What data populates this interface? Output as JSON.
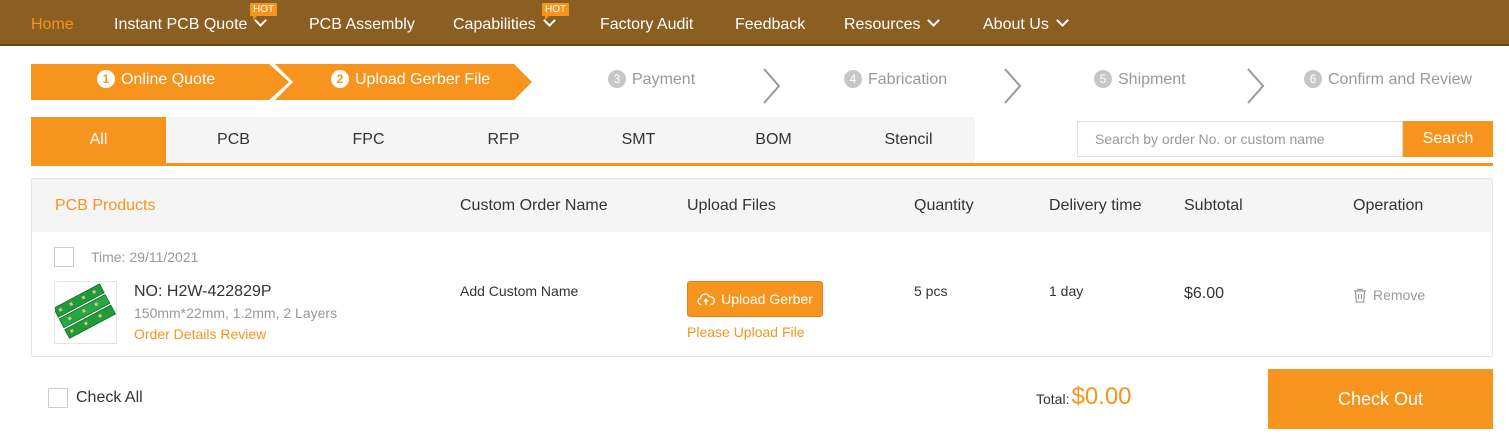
{
  "nav": {
    "items": [
      {
        "label": "Home"
      },
      {
        "label": "Instant PCB Quote",
        "badge": "HOT"
      },
      {
        "label": "PCB Assembly"
      },
      {
        "label": "Capabilities",
        "badge": "HOT"
      },
      {
        "label": "Factory Audit"
      },
      {
        "label": "Feedback"
      },
      {
        "label": "Resources"
      },
      {
        "label": "About Us"
      }
    ]
  },
  "steps": [
    {
      "num": "1",
      "label": "Online Quote"
    },
    {
      "num": "2",
      "label": "Upload Gerber File"
    },
    {
      "num": "3",
      "label": "Payment"
    },
    {
      "num": "4",
      "label": "Fabrication"
    },
    {
      "num": "5",
      "label": "Shipment"
    },
    {
      "num": "6",
      "label": "Confirm and Review"
    }
  ],
  "tabs": [
    {
      "label": "All"
    },
    {
      "label": "PCB"
    },
    {
      "label": "FPC"
    },
    {
      "label": "RFP"
    },
    {
      "label": "SMT"
    },
    {
      "label": "BOM"
    },
    {
      "label": "Stencil"
    }
  ],
  "search": {
    "placeholder": "Search by order No. or custom name",
    "value": "",
    "button": "Search"
  },
  "table": {
    "headers": {
      "products": "PCB Products",
      "custom_name": "Custom Order Name",
      "upload": "Upload Files",
      "quantity": "Quantity",
      "delivery": "Delivery time",
      "subtotal": "Subtotal",
      "operation": "Operation"
    },
    "row": {
      "time": "Time: 29/11/2021",
      "order_no": "NO: H2W-422829P",
      "specs": "150mm*22mm, 1.2mm, 2 Layers",
      "details_link": "Order Details Review",
      "custom_name": "Add Custom Name",
      "upload_button": "Upload Gerber",
      "upload_hint": "Please Upload File",
      "quantity": "5 pcs",
      "delivery": "1 day",
      "subtotal": "$6.00",
      "remove": "Remove"
    }
  },
  "footer": {
    "check_all": "Check All",
    "total_label": "Total:",
    "total_value": "$0.00",
    "checkout": "Check Out"
  },
  "colors": {
    "nav_bg": "#8b5e22",
    "accent": "#f7941d",
    "inactive_step": "#999999"
  }
}
